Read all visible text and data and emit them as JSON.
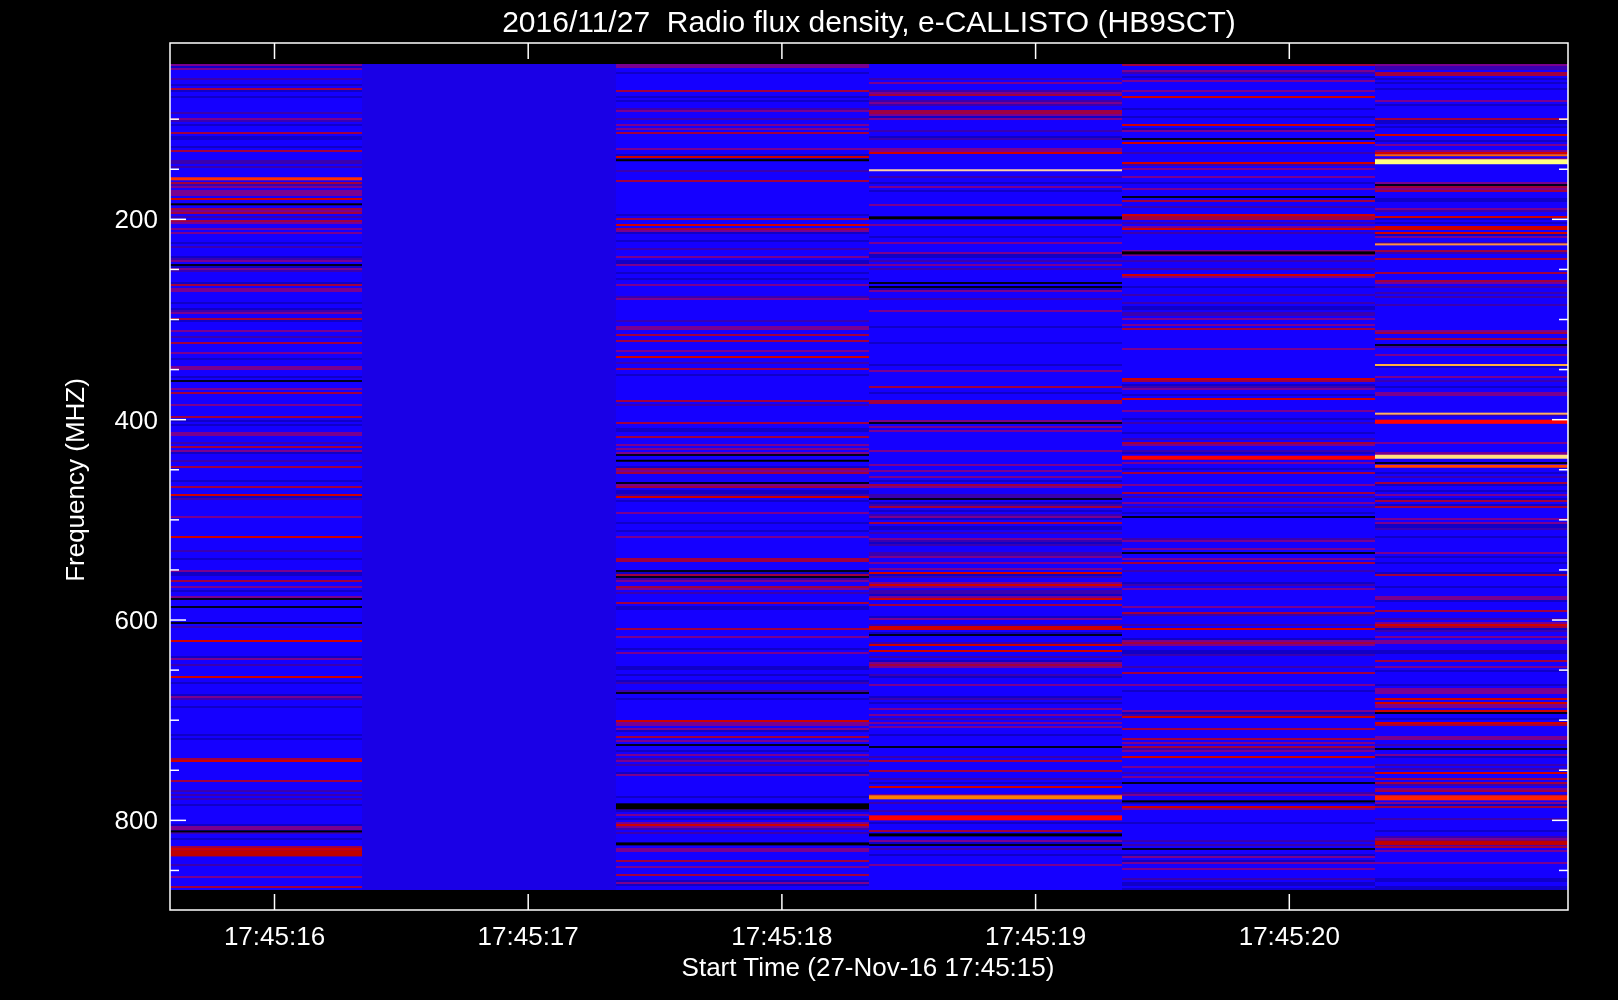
{
  "title": "2016/11/27  Radio flux density, e-CALLISTO (HB9SCT)",
  "y_axis": {
    "label": "Frequency (MHZ)",
    "ticks": [
      "200",
      "400",
      "600",
      "800"
    ]
  },
  "x_axis": {
    "label": "Start Time (27-Nov-16 17:45:15)",
    "ticks": [
      "17:45:16",
      "17:45:17",
      "17:45:18",
      "17:45:19",
      "17:45:20"
    ]
  }
}
